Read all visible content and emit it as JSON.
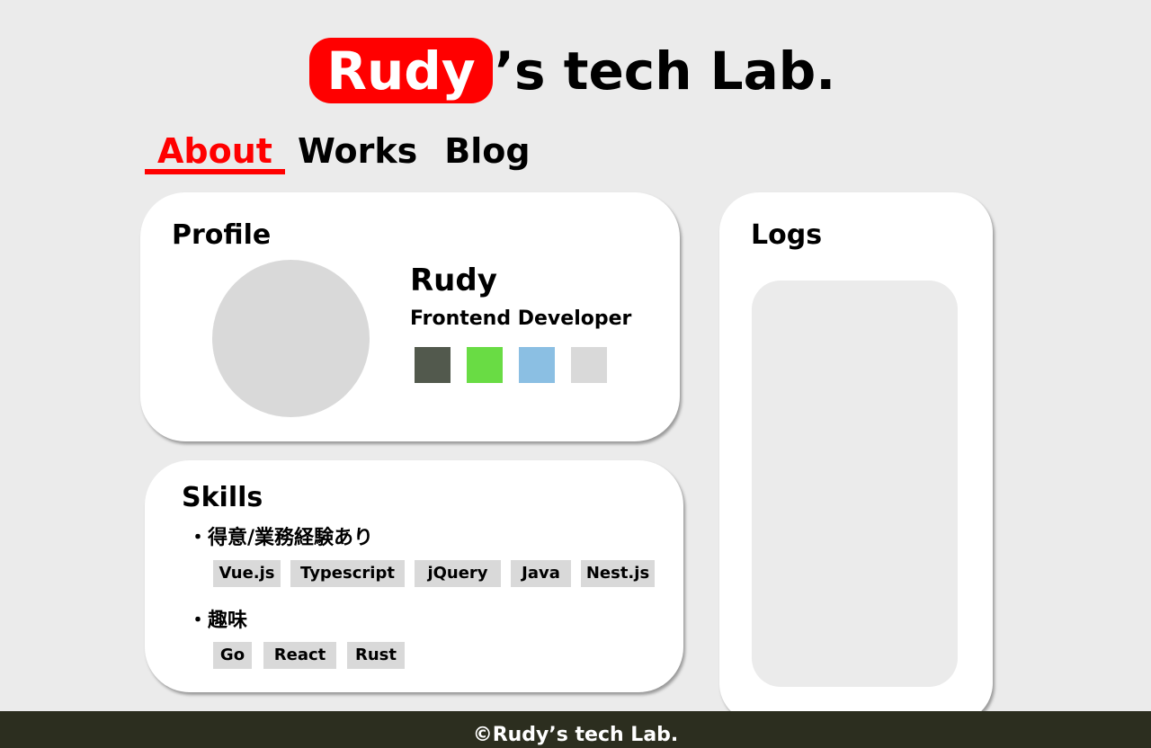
{
  "header": {
    "logo_highlight": "Rudy",
    "logo_rest": "’s tech Lab.",
    "accent_color": "#ff0000"
  },
  "nav": {
    "items": [
      {
        "label": "About",
        "active": true
      },
      {
        "label": "Works",
        "active": false
      },
      {
        "label": "Blog",
        "active": false
      }
    ]
  },
  "profile": {
    "title": "Profile",
    "name": "Rudy",
    "role": "Frontend Developer",
    "swatches": [
      "#52594d",
      "#69dc44",
      "#8bbfe3",
      "#d9d9d9"
    ]
  },
  "skills": {
    "title": "Skills",
    "sections": [
      {
        "heading": "・得意/業務経験あり",
        "tags": [
          "Vue.js",
          "Typescript",
          "jQuery",
          "Java",
          "Nest.js"
        ]
      },
      {
        "heading": "・趣味",
        "tags": [
          "Go",
          "React",
          "Rust"
        ]
      }
    ]
  },
  "logs": {
    "title": "Logs"
  },
  "footer": {
    "text": "©Rudy’s tech Lab."
  }
}
